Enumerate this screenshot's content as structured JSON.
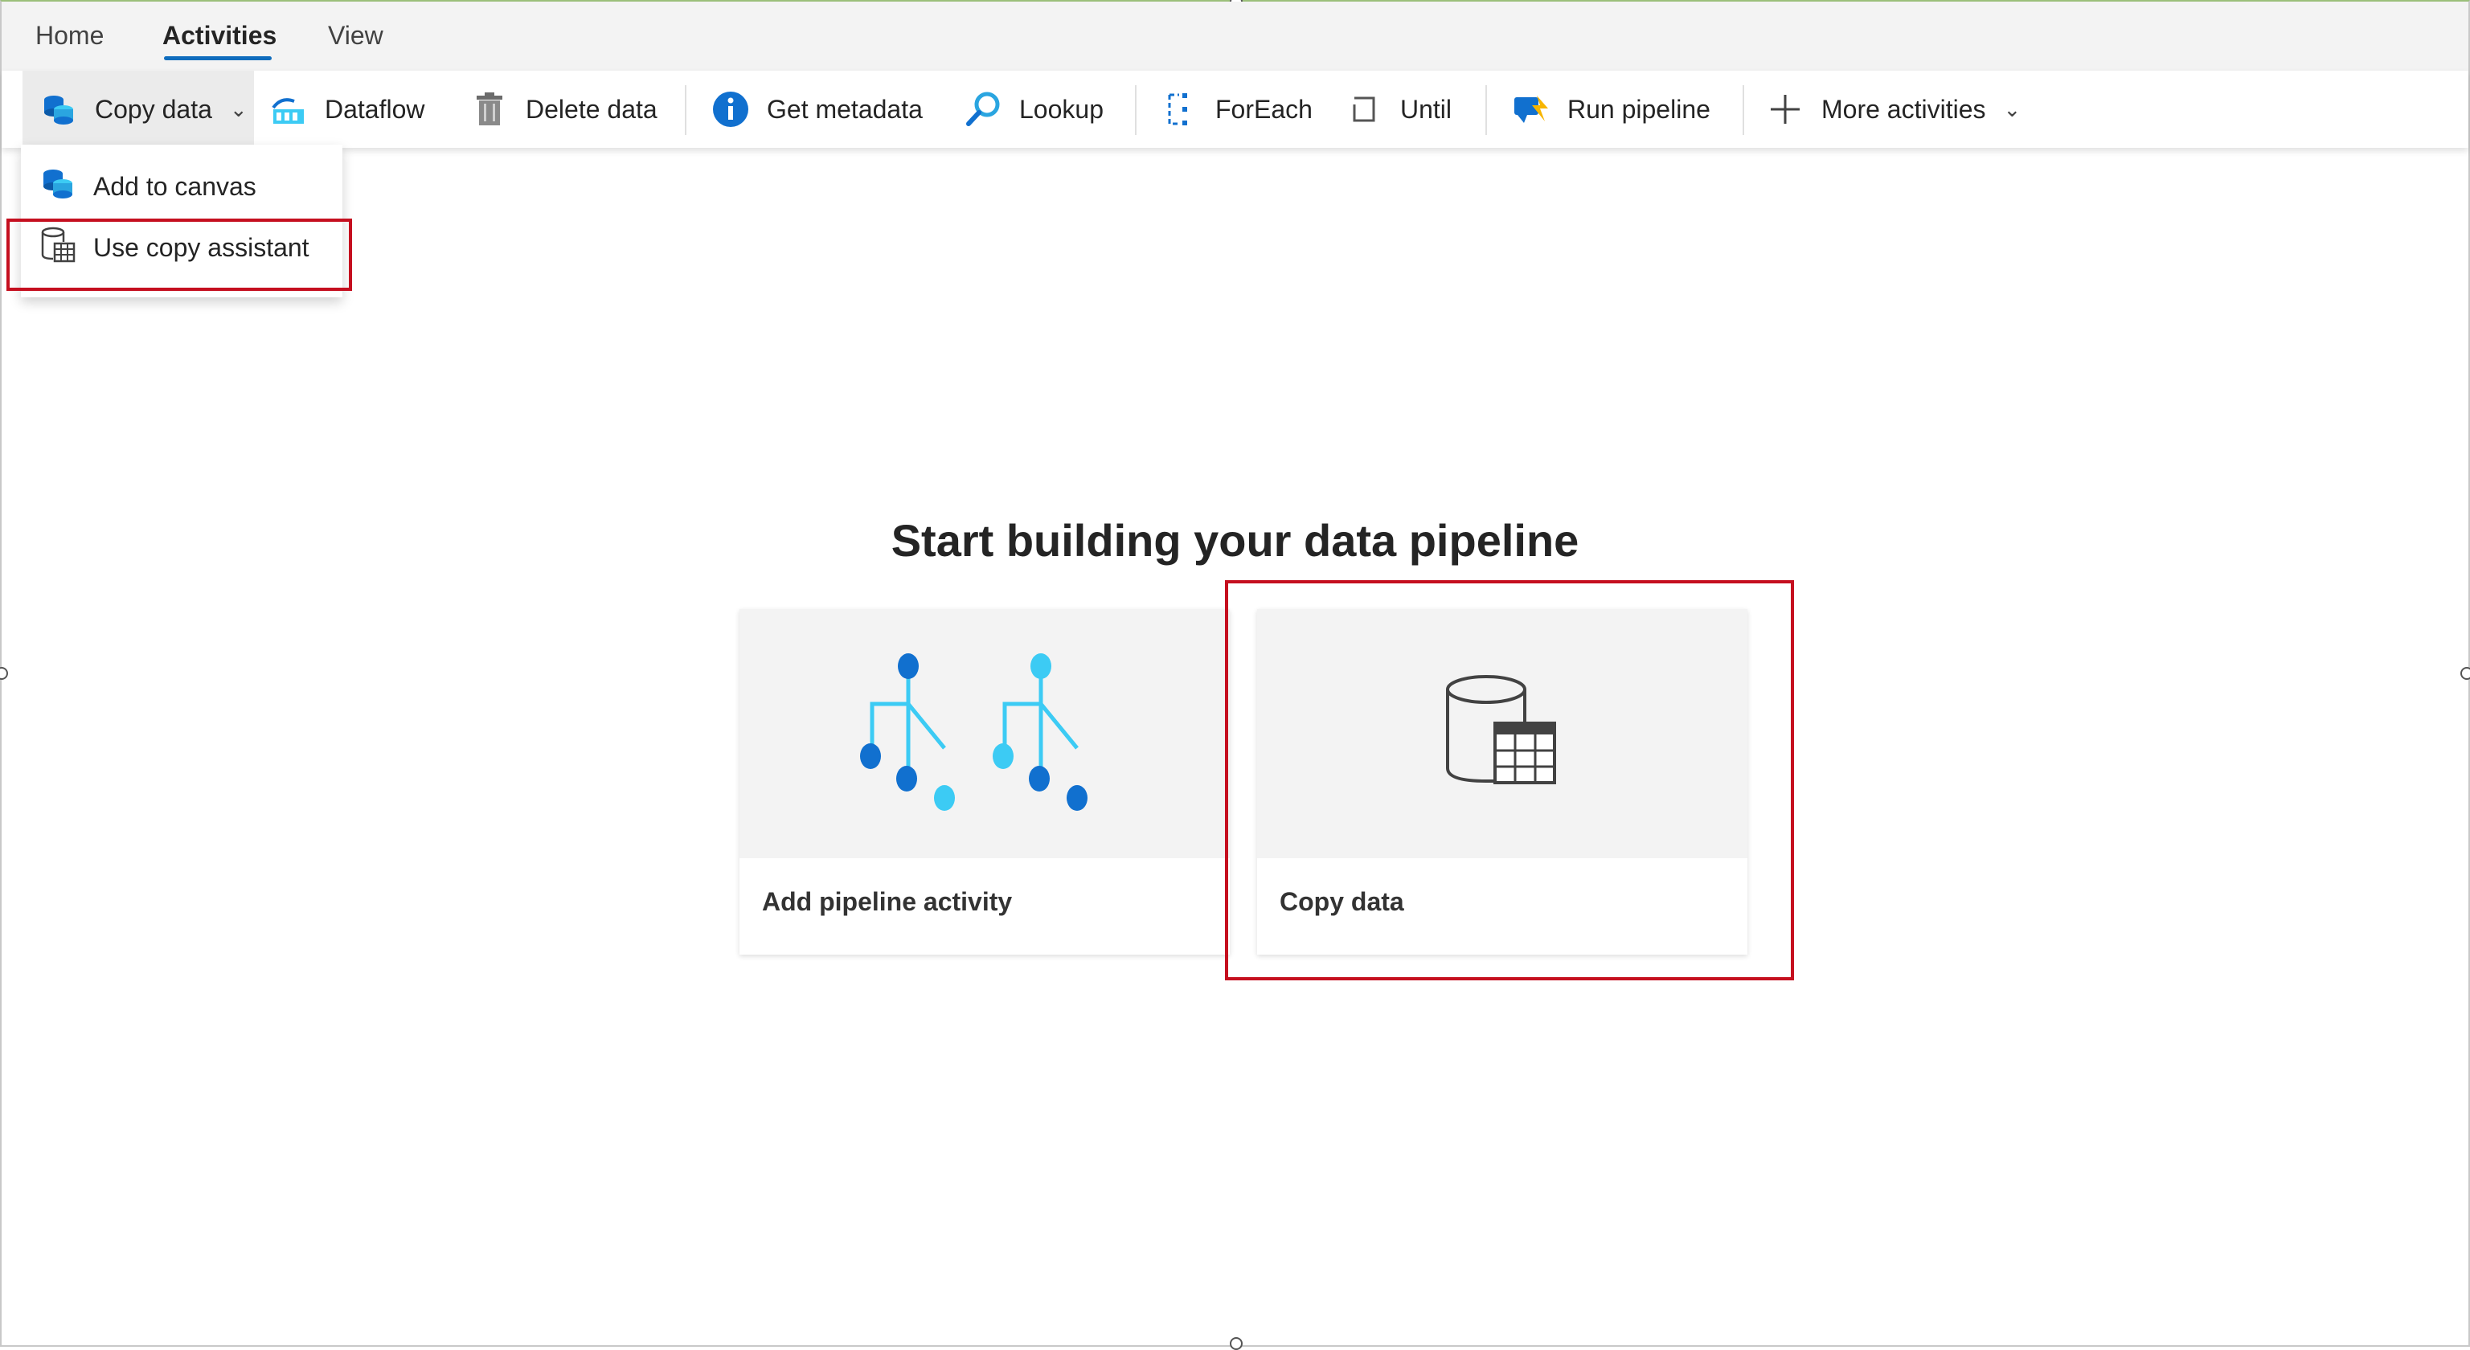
{
  "tabs": [
    {
      "label": "Home",
      "active": false
    },
    {
      "label": "Activities",
      "active": true
    },
    {
      "label": "View",
      "active": false
    }
  ],
  "ribbon": {
    "copy_data": "Copy data",
    "dataflow": "Dataflow",
    "delete_data": "Delete data",
    "get_metadata": "Get metadata",
    "lookup": "Lookup",
    "foreach": "ForEach",
    "until": "Until",
    "run_pipeline": "Run pipeline",
    "more_activities": "More activities"
  },
  "dropdown": {
    "add_to_canvas": "Add to canvas",
    "use_copy_assistant": "Use copy assistant"
  },
  "main": {
    "heading": "Start building your data pipeline",
    "cards": [
      {
        "label": "Add pipeline activity",
        "icon": "pipeline-activity-icon"
      },
      {
        "label": "Copy data",
        "icon": "database-table-icon",
        "highlighted": true
      }
    ]
  },
  "colors": {
    "accent": "#0f6cbd",
    "highlight_border": "#c50f1f",
    "icon_blue_dark": "#1170cf",
    "icon_blue_light": "#3ccbf4"
  }
}
